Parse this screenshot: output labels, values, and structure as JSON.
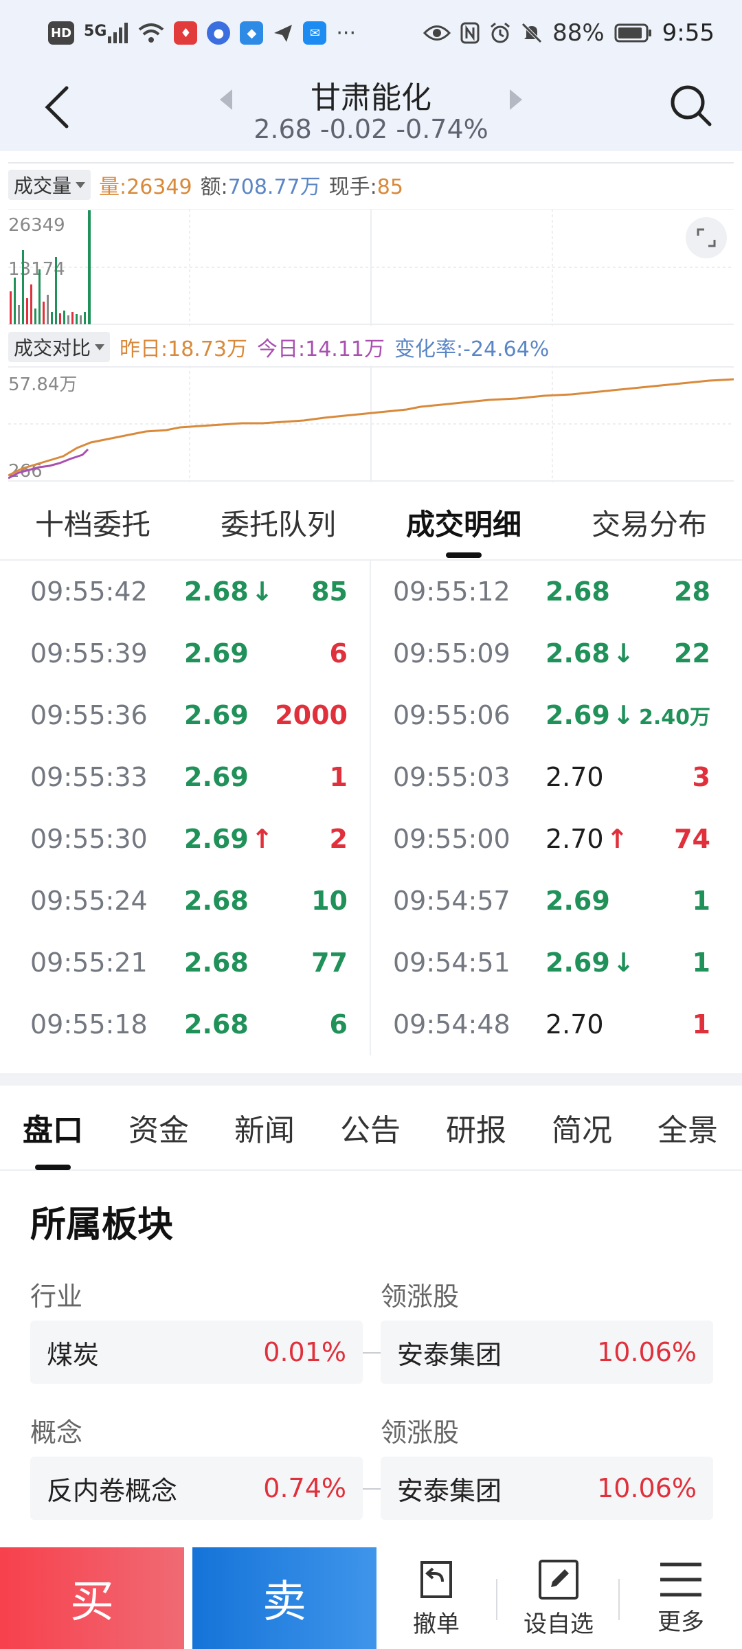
{
  "status_bar": {
    "left_icons": [
      "hd-icon",
      "signal-5g-icon",
      "wifi-icon",
      "app-icon-1",
      "app-icon-2",
      "app-icon-3",
      "send-icon",
      "mail-icon",
      "more-dots-icon"
    ],
    "hd": "HD",
    "network": "5G",
    "right_icons": [
      "eye-icon",
      "nfc-icon",
      "alarm-icon",
      "mute-icon",
      "battery-icon"
    ],
    "battery": "88%",
    "time": "9:55"
  },
  "header": {
    "title": "甘肃能化",
    "subtitle": "2.68 -0.02 -0.74%"
  },
  "volume": {
    "selector": "成交量",
    "vol_label": "量:",
    "vol_value": "26349",
    "amt_label": "额:",
    "amt_value": "708.77万",
    "hand_label": "现手:",
    "hand_value": "85",
    "max_label": "26349",
    "mid_label": "13174"
  },
  "compare": {
    "selector": "成交对比",
    "yesterday": "昨日:18.73万",
    "today": "今日:14.11万",
    "change": "变化率:-24.64%",
    "max_label": "57.84万",
    "min_label": "266"
  },
  "tabs_top": [
    {
      "label": "十档委托",
      "active": false
    },
    {
      "label": "委托队列",
      "active": false
    },
    {
      "label": "成交明细",
      "active": true
    },
    {
      "label": "交易分布",
      "active": false
    }
  ],
  "trades_left": [
    {
      "time": "09:55:42",
      "price": "2.68",
      "arrow": "↓",
      "arrow_color": "green",
      "price_color": "green",
      "vol": "85",
      "vol_color": "green"
    },
    {
      "time": "09:55:39",
      "price": "2.69",
      "arrow": "",
      "arrow_color": "",
      "price_color": "green",
      "vol": "6",
      "vol_color": "red"
    },
    {
      "time": "09:55:36",
      "price": "2.69",
      "arrow": "",
      "arrow_color": "",
      "price_color": "green",
      "vol": "2000",
      "vol_color": "red"
    },
    {
      "time": "09:55:33",
      "price": "2.69",
      "arrow": "",
      "arrow_color": "",
      "price_color": "green",
      "vol": "1",
      "vol_color": "red"
    },
    {
      "time": "09:55:30",
      "price": "2.69",
      "arrow": "↑",
      "arrow_color": "red",
      "price_color": "green",
      "vol": "2",
      "vol_color": "red"
    },
    {
      "time": "09:55:24",
      "price": "2.68",
      "arrow": "",
      "arrow_color": "",
      "price_color": "green",
      "vol": "10",
      "vol_color": "green"
    },
    {
      "time": "09:55:21",
      "price": "2.68",
      "arrow": "",
      "arrow_color": "",
      "price_color": "green",
      "vol": "77",
      "vol_color": "green"
    },
    {
      "time": "09:55:18",
      "price": "2.68",
      "arrow": "",
      "arrow_color": "",
      "price_color": "green",
      "vol": "6",
      "vol_color": "green"
    }
  ],
  "trades_right": [
    {
      "time": "09:55:12",
      "price": "2.68",
      "arrow": "",
      "arrow_color": "",
      "price_color": "green",
      "vol": "28",
      "vol_color": "green"
    },
    {
      "time": "09:55:09",
      "price": "2.68",
      "arrow": "↓",
      "arrow_color": "green",
      "price_color": "green",
      "vol": "22",
      "vol_color": "green"
    },
    {
      "time": "09:55:06",
      "price": "2.69",
      "arrow": "↓",
      "arrow_color": "green",
      "price_color": "green",
      "vol": "2.40万",
      "vol_color": "green"
    },
    {
      "time": "09:55:03",
      "price": "2.70",
      "arrow": "",
      "arrow_color": "",
      "price_color": "black",
      "vol": "3",
      "vol_color": "red"
    },
    {
      "time": "09:55:00",
      "price": "2.70",
      "arrow": "↑",
      "arrow_color": "red",
      "price_color": "black",
      "vol": "74",
      "vol_color": "red"
    },
    {
      "time": "09:54:57",
      "price": "2.69",
      "arrow": "",
      "arrow_color": "",
      "price_color": "green",
      "vol": "1",
      "vol_color": "green"
    },
    {
      "time": "09:54:51",
      "price": "2.69",
      "arrow": "↓",
      "arrow_color": "green",
      "price_color": "green",
      "vol": "1",
      "vol_color": "green"
    },
    {
      "time": "09:54:48",
      "price": "2.70",
      "arrow": "",
      "arrow_color": "",
      "price_color": "black",
      "vol": "1",
      "vol_color": "red"
    }
  ],
  "tabs_bottom": [
    {
      "label": "盘口",
      "active": true
    },
    {
      "label": "资金",
      "active": false
    },
    {
      "label": "新闻",
      "active": false
    },
    {
      "label": "公告",
      "active": false
    },
    {
      "label": "研报",
      "active": false
    },
    {
      "label": "简况",
      "active": false
    },
    {
      "label": "全景",
      "active": false
    }
  ],
  "sectors": {
    "title": "所属板块",
    "rows": [
      {
        "label": "行业",
        "name": "煤炭",
        "pct": "0.01%",
        "lead_label": "领涨股",
        "lead_name": "安泰集团",
        "lead_pct": "10.06%"
      },
      {
        "label": "概念",
        "name": "反内卷概念",
        "pct": "0.74%",
        "lead_label": "领涨股",
        "lead_name": "安泰集团",
        "lead_pct": "10.06%"
      }
    ]
  },
  "bottom_bar": {
    "buy": "买",
    "sell": "卖",
    "cancel": "撤单",
    "watch": "设自选",
    "more": "更多"
  },
  "colors": {
    "up": "#e0303b",
    "down": "#1f9159",
    "buy": "#f7414d",
    "sell": "#1573d8",
    "yesterday_line": "#d9893a",
    "today_line": "#a94fb0"
  }
}
